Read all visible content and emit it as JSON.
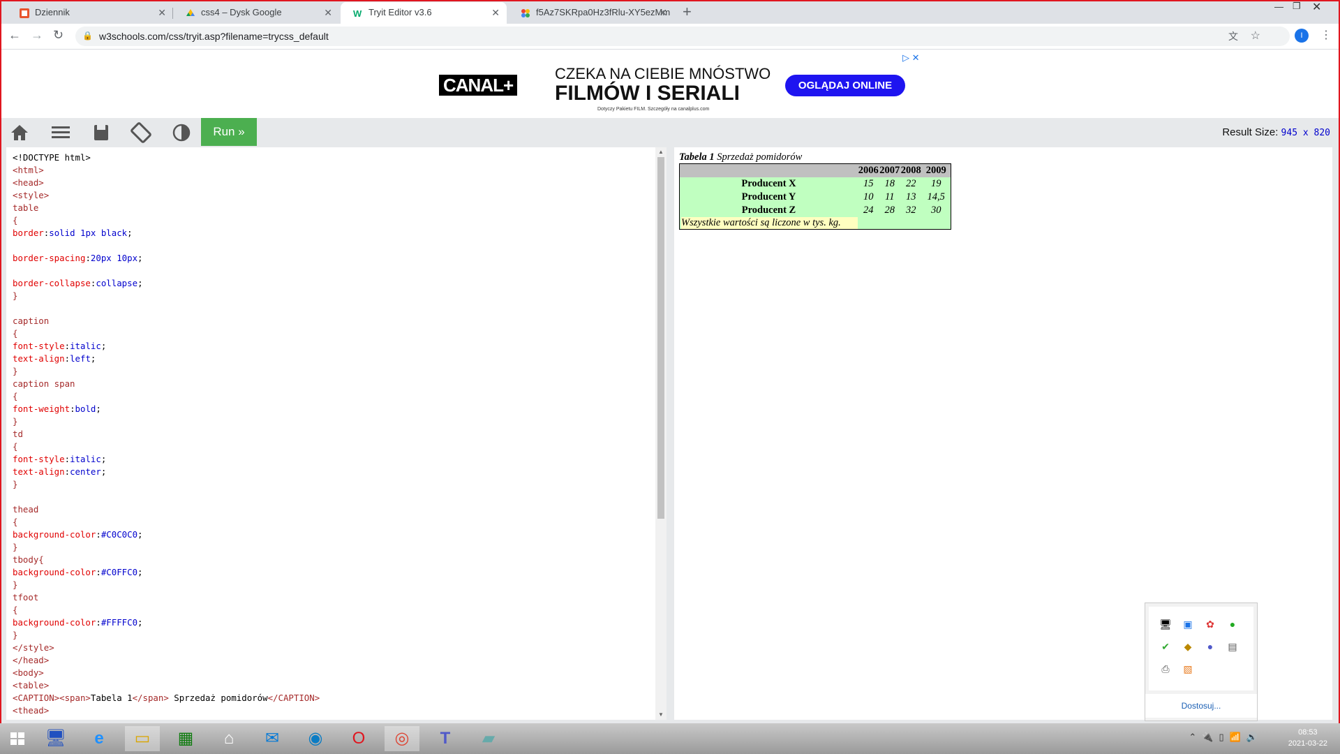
{
  "tabs": [
    {
      "title": "Dziennik",
      "active": false
    },
    {
      "title": "css4 – Dysk Google",
      "active": false
    },
    {
      "title": "Tryit Editor v3.6",
      "active": true
    },
    {
      "title": "f5Az7SKRpa0Hz3fRlu-XY5ezMm",
      "active": false
    }
  ],
  "address": {
    "url": "w3schools.com/css/tryit.asp?filename=trycss_default"
  },
  "profile": {
    "initial": "I"
  },
  "ad": {
    "brand": "CANAL+",
    "line1": "CZEKA NA CIEBIE MNÓSTWO",
    "line2": "FILMÓW I SERIALI",
    "small": "Dotyczy Pakietu FILM. Szczegóły na canalplus.com",
    "cta": "OGLĄDAJ ONLINE"
  },
  "editor": {
    "run_label": "Run »",
    "result_size_label": "Result Size:",
    "result_size_value": "945 x 820"
  },
  "preview": {
    "caption_bold": "Tabela 1",
    "caption_rest": " Sprzedaż pomidorów",
    "years": [
      "2006",
      "2007",
      "2008",
      "2009"
    ],
    "rows": [
      {
        "name": "Producent X",
        "values": [
          "15",
          "18",
          "22",
          "19"
        ]
      },
      {
        "name": "Producent Y",
        "values": [
          "10",
          "11",
          "13",
          "14,5"
        ]
      },
      {
        "name": "Producent Z",
        "values": [
          "24",
          "28",
          "32",
          "30"
        ]
      }
    ],
    "footer": "Wszystkie wartości są liczone w tys. kg."
  },
  "tray_popup": {
    "customize_label": "Dostosuj..."
  },
  "clock": {
    "time": "08:53",
    "date": "2021-03-22"
  },
  "colors": {
    "run": "#4caf50",
    "thead": "#C0C0C0",
    "tbody": "#C0FFC0",
    "tfoot": "#FFFFC0",
    "ad_cta": "#1e14f0"
  }
}
